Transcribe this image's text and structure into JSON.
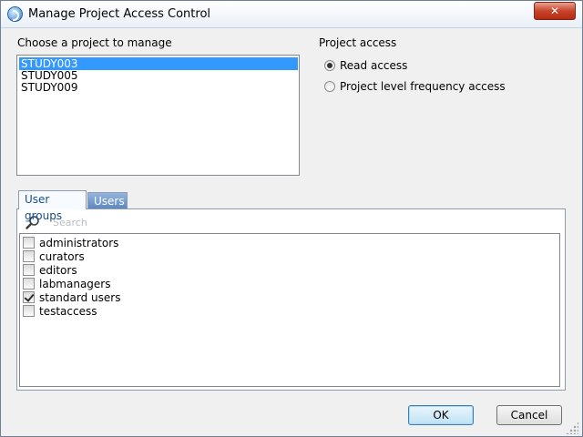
{
  "window": {
    "title": "Manage Project Access Control",
    "close_glyph": "✕"
  },
  "projects": {
    "label": "Choose a project to manage",
    "items": [
      "STUDY003",
      "STUDY005",
      "STUDY009"
    ],
    "selected_index": 0
  },
  "access": {
    "label": "Project access",
    "options": [
      {
        "label": "Read access",
        "checked": true
      },
      {
        "label": "Project level frequency access",
        "checked": false
      }
    ]
  },
  "tabs": [
    {
      "label": "User groups",
      "active": true
    },
    {
      "label": "Users",
      "active": false
    }
  ],
  "search": {
    "placeholder": "Search",
    "value": ""
  },
  "groups": [
    {
      "label": "administrators",
      "checked": false
    },
    {
      "label": "curators",
      "checked": false
    },
    {
      "label": "editors",
      "checked": false
    },
    {
      "label": "labmanagers",
      "checked": false
    },
    {
      "label": "standard users",
      "checked": true
    },
    {
      "label": "testaccess",
      "checked": false
    }
  ],
  "buttons": {
    "ok": "OK",
    "cancel": "Cancel"
  },
  "icons": {
    "app": "app-logo-icon",
    "search": "magnifier-icon",
    "close": "close-icon"
  },
  "colors": {
    "selection": "#3399ff",
    "close_button": "#c7442b",
    "tab_inactive": "#5f88c0"
  }
}
